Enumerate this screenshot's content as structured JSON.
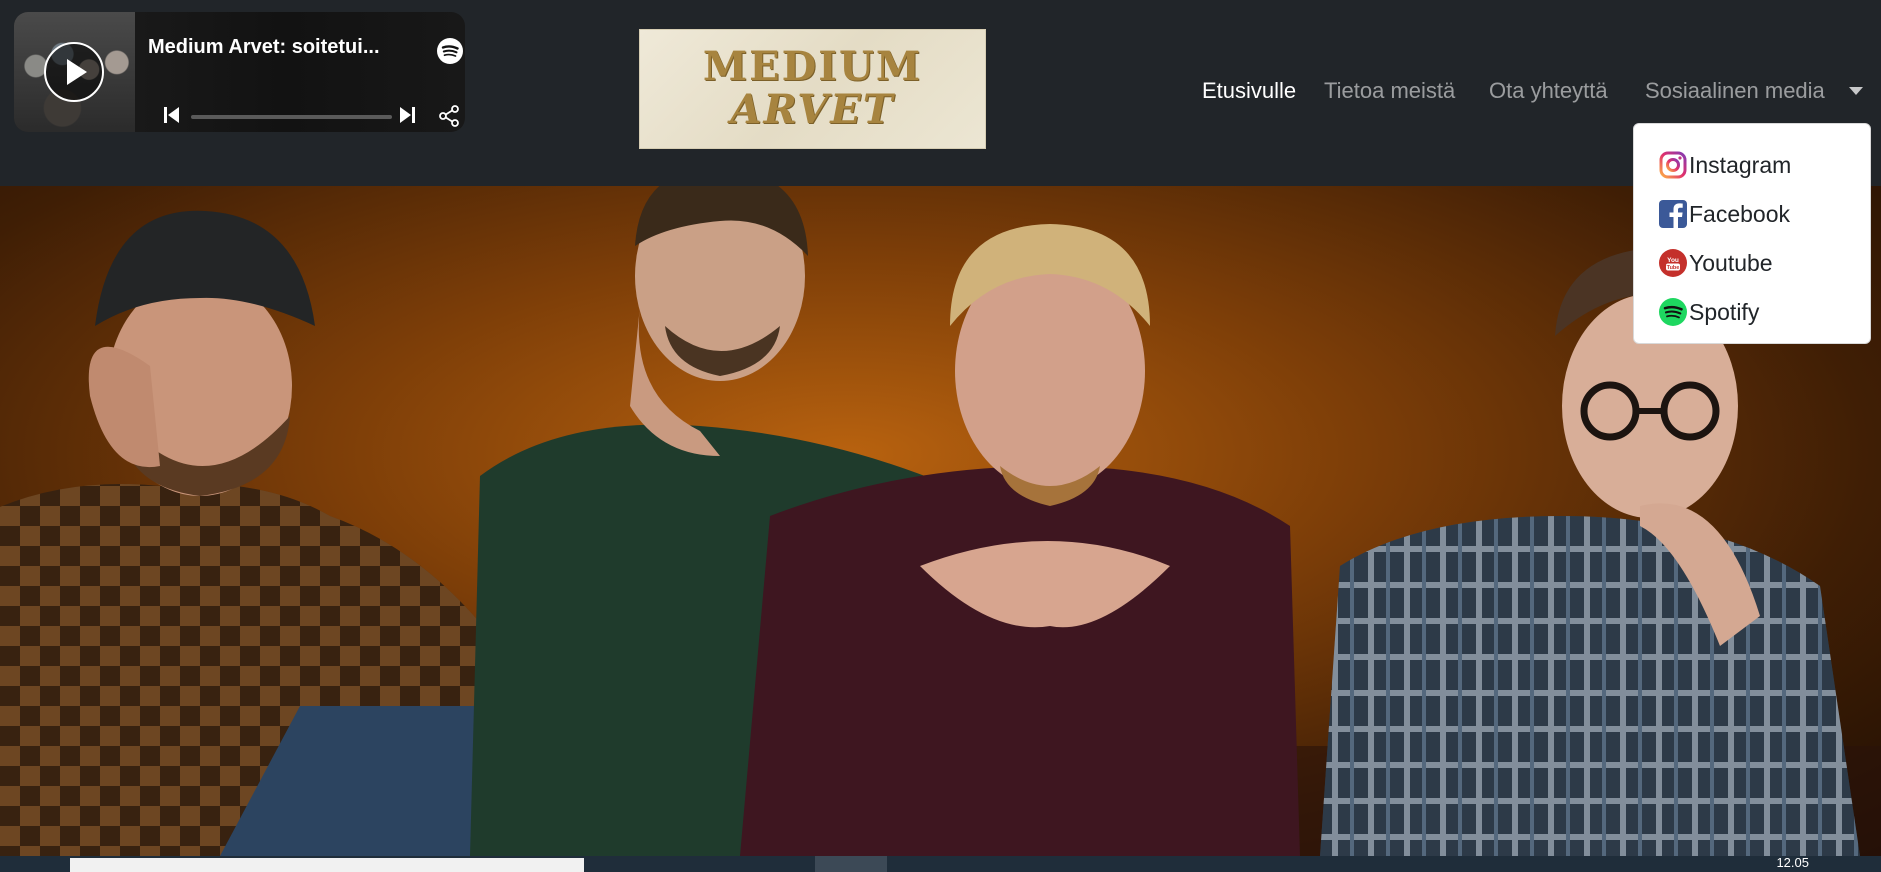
{
  "player": {
    "title": "Medium Arvet: soitetui...",
    "progress": 0,
    "icons": [
      "play-icon",
      "spotify-logo-icon",
      "previous-track-icon",
      "next-track-icon",
      "share-icon"
    ]
  },
  "logo": {
    "line1": "MEDIUM",
    "line2": "ARVET"
  },
  "nav": {
    "items": [
      {
        "label": "Etusivulle",
        "active": true
      },
      {
        "label": "Tietoa meistä",
        "active": false
      },
      {
        "label": "Ota yhteyttä",
        "active": false
      },
      {
        "label": "Sosiaalinen media",
        "active": false
      }
    ]
  },
  "dropdown": {
    "items": [
      {
        "label": "Instagram",
        "icon": "instagram-icon"
      },
      {
        "label": "Facebook",
        "icon": "facebook-icon"
      },
      {
        "label": "Youtube",
        "icon": "youtube-icon"
      },
      {
        "label": "Spotify",
        "icon": "spotify-icon"
      }
    ]
  },
  "hero": {
    "alt": "band photo"
  },
  "taskbar": {
    "time": "12.05"
  },
  "colors": {
    "header_bg": "#212529",
    "nav_active": "#ffffff",
    "nav_inactive": "#8f9295",
    "logo_gold": "#a7843f",
    "spotify_green": "#1ed760",
    "instagram": "#d6249f",
    "facebook": "#1877f2",
    "youtube": "#e62117"
  }
}
